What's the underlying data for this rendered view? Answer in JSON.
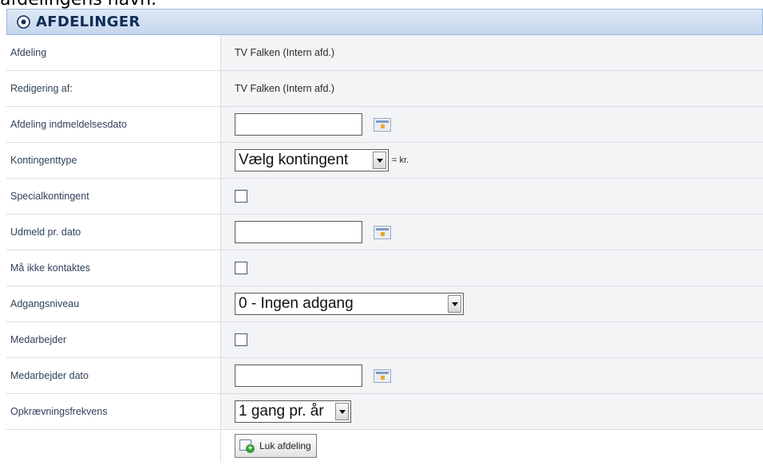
{
  "top_caption": "afdelingens navn.",
  "panel": {
    "title": "AFDELINGER"
  },
  "rows": {
    "afdeling": {
      "label": "Afdeling",
      "value": "TV Falken (Intern afd.)"
    },
    "redigering": {
      "label": "Redigering af:",
      "value": "TV Falken (Intern afd.)"
    },
    "indmeldelsesdato": {
      "label": "Afdeling indmeldelsesdato",
      "value": ""
    },
    "kontingenttype": {
      "label": "Kontingenttype",
      "selected": "Vælg kontingent",
      "suffix": "= kr."
    },
    "specialkontingent": {
      "label": "Specialkontingent",
      "checked": false
    },
    "udmeld": {
      "label": "Udmeld pr. dato",
      "value": ""
    },
    "ikke_kontaktes": {
      "label": "Må ikke kontaktes",
      "checked": false
    },
    "adgangsniveau": {
      "label": "Adgangsniveau",
      "selected": "0 - Ingen adgang"
    },
    "medarbejder": {
      "label": "Medarbejder",
      "checked": false
    },
    "medarbejder_dato": {
      "label": "Medarbejder dato",
      "value": ""
    },
    "opkraevning": {
      "label": "Opkrævningsfrekvens",
      "selected": "1 gang pr. år"
    }
  },
  "actions": {
    "close_label": "Luk afdeling"
  },
  "icons": {
    "header": "collapse-circle-icon",
    "calendar": "calendar-icon",
    "dropdown": "chevron-down-icon",
    "close_button": "add-green-icon"
  },
  "colors": {
    "header_bg": "#c4d6ee",
    "header_text": "#0f2d55",
    "label_text": "#30415a",
    "value_bg": "#f3f4f6"
  }
}
